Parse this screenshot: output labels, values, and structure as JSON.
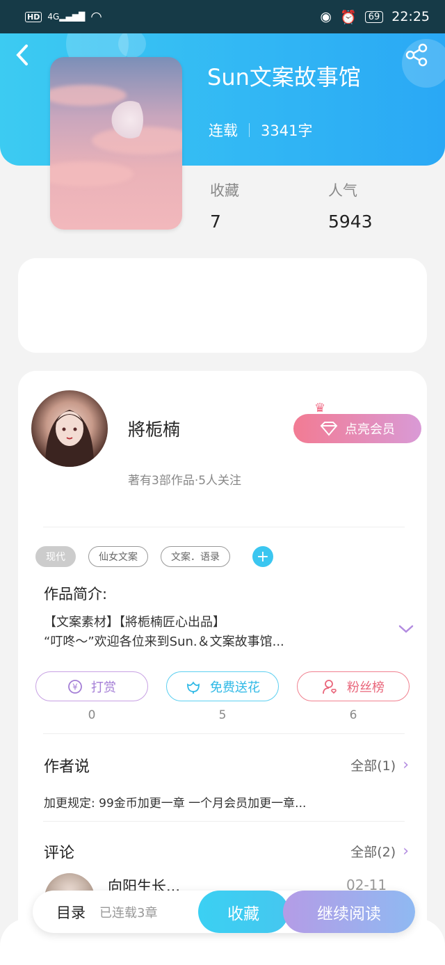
{
  "status_bar": {
    "hd": "HD",
    "network": "4G",
    "battery": "69",
    "time": "22:25"
  },
  "book": {
    "title": "Sun文案故事馆",
    "status": "连载",
    "word_count": "3341字"
  },
  "stats": {
    "favorites_label": "收藏",
    "favorites_value": "7",
    "popularity_label": "人气",
    "popularity_value": "5943"
  },
  "author": {
    "name": "將栀楠",
    "meta": "著有3部作品·5人关注",
    "vip_label": "点亮会员"
  },
  "tags": [
    "现代",
    "仙女文案",
    "文案．语录"
  ],
  "intro": {
    "title": "作品简介:",
    "line1": "【文案素材】【將栀楠匠心出品】",
    "line2": "“叮咚～”欢迎各位来到Sun.＆文案故事馆..."
  },
  "actions": [
    {
      "label": "打赏",
      "count": "0"
    },
    {
      "label": "免费送花",
      "count": "5"
    },
    {
      "label": "粉丝榜",
      "count": "6"
    }
  ],
  "author_says": {
    "title": "作者说",
    "more": "全部(1)",
    "text": "加更规定: 99金币加更一章 一个月会员加更一章..."
  },
  "comments": {
    "title": "评论",
    "more": "全部(2)",
    "first_name": "向阳生长...",
    "first_date": "02-11"
  },
  "bottom": {
    "toc": "目录",
    "toc_sub": "已连载3章",
    "favorite": "收藏",
    "continue": "继续阅读"
  },
  "colors": {
    "header_start": "#3ccbf2",
    "header_end": "#2aa8f5",
    "accent_blue": "#3bc6f0",
    "accent_purple": "#b28be0",
    "accent_pink": "#f06a85"
  }
}
